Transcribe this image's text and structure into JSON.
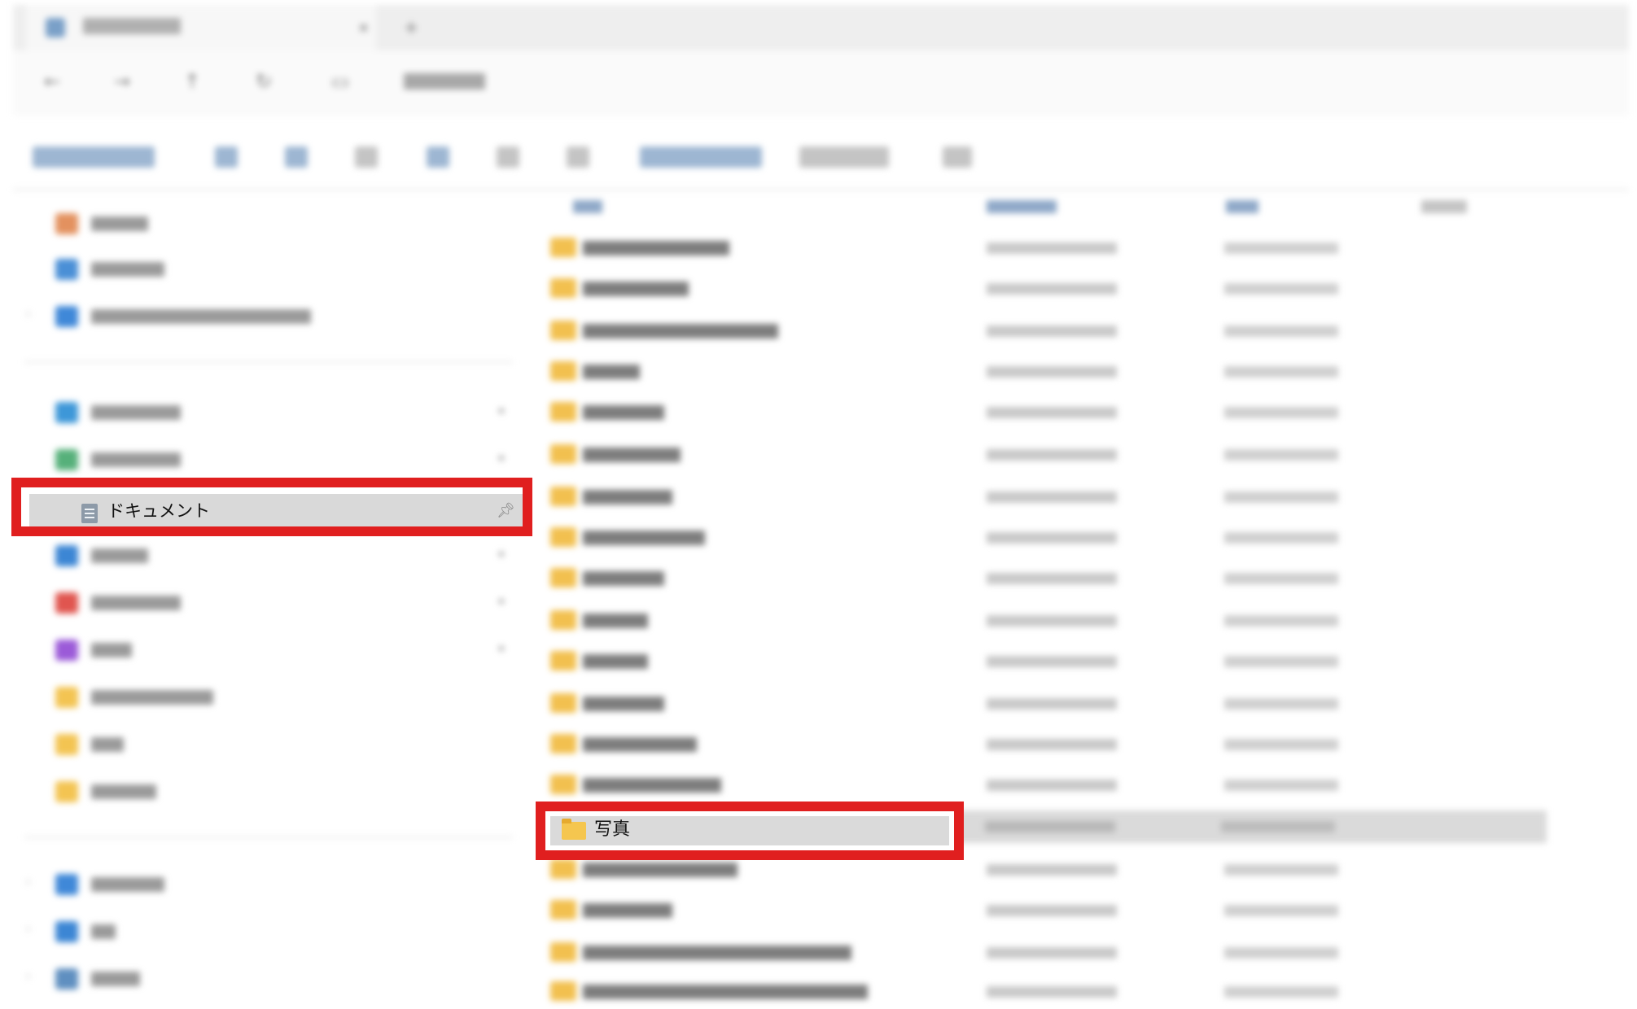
{
  "sidebar": {
    "highlighted_item": {
      "label": "ドキュメント",
      "icon": "document-icon",
      "pin": "pin-icon"
    }
  },
  "content": {
    "highlighted_folder": {
      "label": "写真",
      "icon": "folder-icon"
    }
  },
  "highlight_color": "#e01f1f"
}
